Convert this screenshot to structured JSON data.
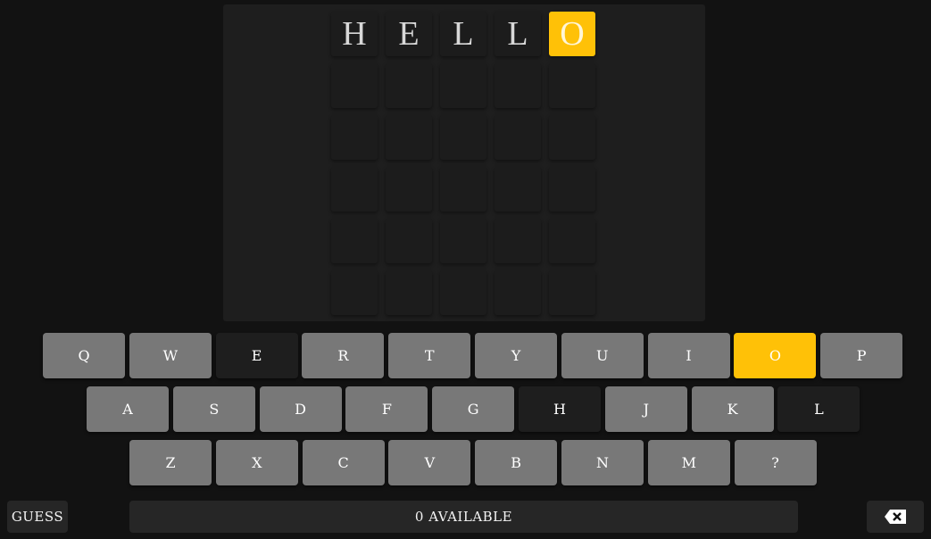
{
  "board": {
    "rows": [
      [
        "H",
        "E",
        "L",
        "L",
        "O"
      ],
      [
        "",
        "",
        "",
        "",
        ""
      ],
      [
        "",
        "",
        "",
        "",
        ""
      ],
      [
        "",
        "",
        "",
        "",
        ""
      ],
      [
        "",
        "",
        "",
        "",
        ""
      ],
      [
        "",
        "",
        "",
        "",
        ""
      ]
    ],
    "states": [
      [
        "none",
        "none",
        "none",
        "none",
        "present"
      ]
    ]
  },
  "keyboard": {
    "rows": [
      [
        {
          "k": "Q",
          "s": "unused"
        },
        {
          "k": "W",
          "s": "unused"
        },
        {
          "k": "E",
          "s": "absent"
        },
        {
          "k": "R",
          "s": "unused"
        },
        {
          "k": "T",
          "s": "unused"
        },
        {
          "k": "Y",
          "s": "unused"
        },
        {
          "k": "U",
          "s": "unused"
        },
        {
          "k": "I",
          "s": "unused"
        },
        {
          "k": "O",
          "s": "present"
        },
        {
          "k": "P",
          "s": "unused"
        }
      ],
      [
        {
          "k": "A",
          "s": "unused"
        },
        {
          "k": "S",
          "s": "unused"
        },
        {
          "k": "D",
          "s": "unused"
        },
        {
          "k": "F",
          "s": "unused"
        },
        {
          "k": "G",
          "s": "unused"
        },
        {
          "k": "H",
          "s": "absent"
        },
        {
          "k": "J",
          "s": "unused"
        },
        {
          "k": "K",
          "s": "unused"
        },
        {
          "k": "L",
          "s": "absent"
        }
      ],
      [
        {
          "k": "Z",
          "s": "unused"
        },
        {
          "k": "X",
          "s": "unused"
        },
        {
          "k": "C",
          "s": "unused"
        },
        {
          "k": "V",
          "s": "unused"
        },
        {
          "k": "B",
          "s": "unused"
        },
        {
          "k": "N",
          "s": "unused"
        },
        {
          "k": "M",
          "s": "unused"
        },
        {
          "k": "?",
          "s": "unused"
        }
      ]
    ]
  },
  "controls": {
    "guess_label": "GUESS",
    "available_label": "0 AVAILABLE",
    "backspace_icon": "backspace-icon"
  },
  "colors": {
    "present": "#ffc107",
    "absent": "#1e1e1e",
    "unused": "#787878"
  }
}
